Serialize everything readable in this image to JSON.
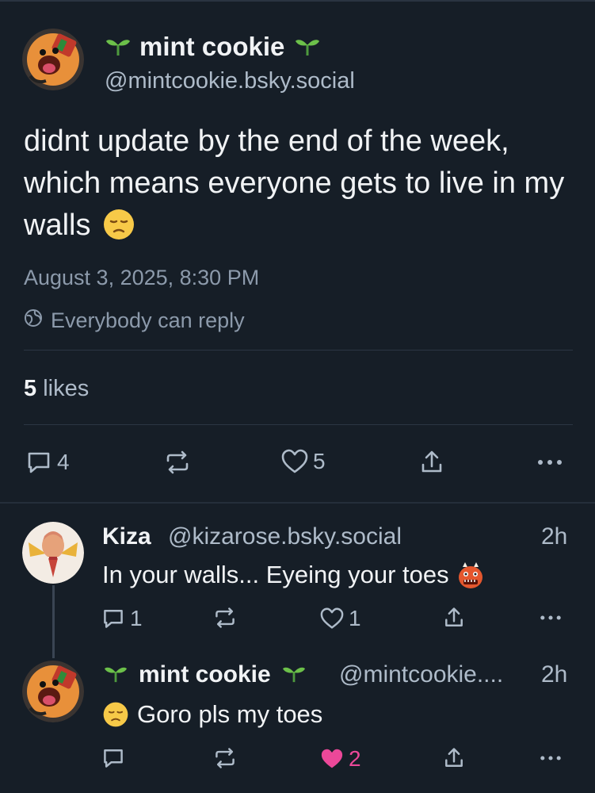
{
  "post": {
    "author_name": "mint cookie",
    "author_handle": "@mintcookie.bsky.social",
    "text": "didnt update by the end of the week, which means everyone gets to live in my walls",
    "text_emoji": "pensive-face",
    "date": "August 3, 2025, 8:30 PM",
    "reply_setting": "Everybody can reply",
    "likes_count": "5",
    "likes_label": "likes",
    "actions": {
      "replies": "4",
      "likes": "5"
    }
  },
  "replies": [
    {
      "author_name": "Kiza",
      "author_handle": "@kizarose.bsky.social",
      "time": "2h",
      "text": "In your walls... Eyeing your toes",
      "text_emoji": "ogre-face",
      "reply_count": "1",
      "like_count": "1",
      "liked": false
    },
    {
      "author_name": "mint cookie",
      "author_handle": "@mintcookie....",
      "time": "2h",
      "text": "Goro pls my toes",
      "text_emoji": "pensive-face",
      "reply_count": "",
      "like_count": "2",
      "liked": true
    }
  ],
  "colors": {
    "background": "#161e27",
    "muted_text": "#aebbc9",
    "like_active": "#ec4899",
    "sprout": "#5cb85c"
  }
}
